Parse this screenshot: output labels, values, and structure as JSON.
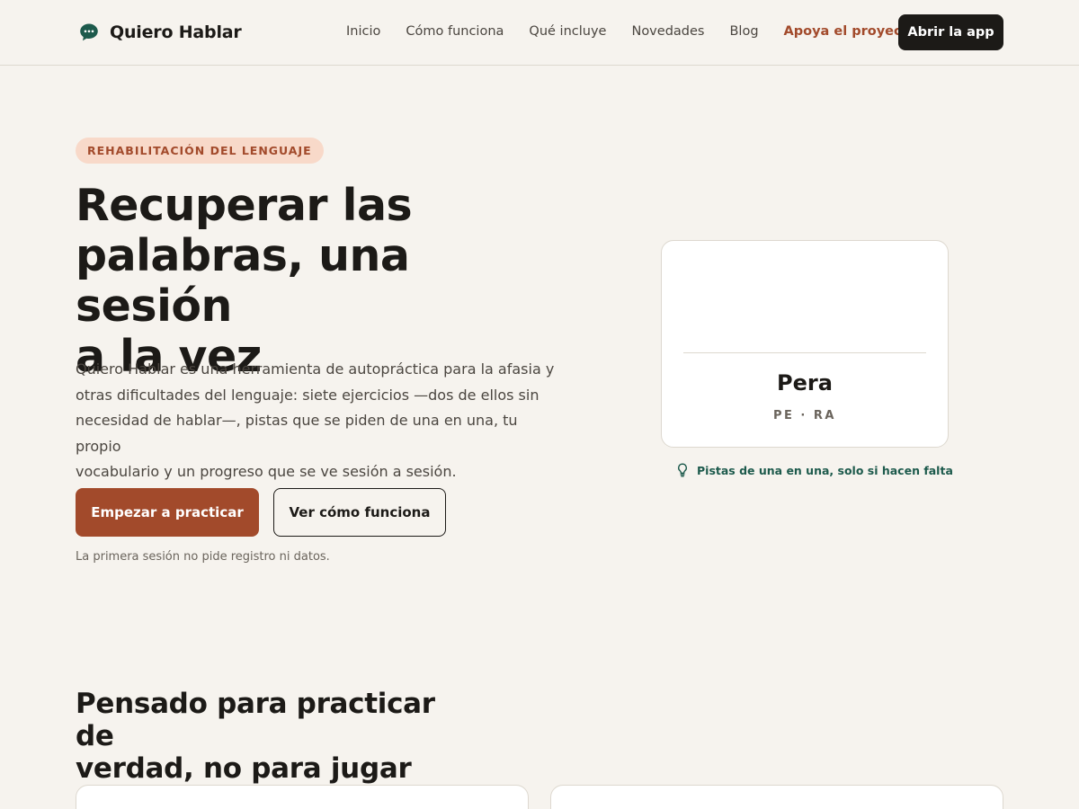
{
  "header": {
    "brand": "Quiero Hablar",
    "nav": [
      {
        "label": "Inicio"
      },
      {
        "label": "Cómo funciona"
      },
      {
        "label": "Qué incluye"
      },
      {
        "label": "Novedades"
      },
      {
        "label": "Blog"
      },
      {
        "label": "Apoya el proyecto"
      }
    ],
    "cta": "Abrir la app",
    "brand_icon": "speech-bubble-icon"
  },
  "hero": {
    "badge": "REHABILITACIÓN DEL LENGUAJE",
    "title_lines": [
      "Recuperar las",
      "palabras, una sesión",
      "a la vez"
    ],
    "description_lines": [
      "Quiero Hablar es una herramienta de autopráctica para la afasia y",
      "otras dificultades del lenguaje: siete ejercicios —dos de ellos sin",
      "necesidad de hablar—, pistas que se piden de una en una, tu propio",
      "vocabulario y un progreso que se ve sesión a sesión."
    ],
    "primary_button": "Empezar a practicar",
    "secondary_button": "Ver cómo funciona",
    "note": "La primera sesión no pide registro ni datos."
  },
  "demo_card": {
    "word": "Pera",
    "syllables": "PE · RA",
    "hint": "Pistas de una en una, solo si hacen falta",
    "hint_icon": "lightbulb-icon"
  },
  "section": {
    "title_lines": [
      "Pensado para practicar de",
      "verdad, no para jugar"
    ]
  },
  "colors": {
    "background": "#f6f3ee",
    "accent": "#a24a2b",
    "dark": "#1c1a17",
    "teal": "#1d5a4c",
    "badge_bg": "#f8d9c9"
  }
}
